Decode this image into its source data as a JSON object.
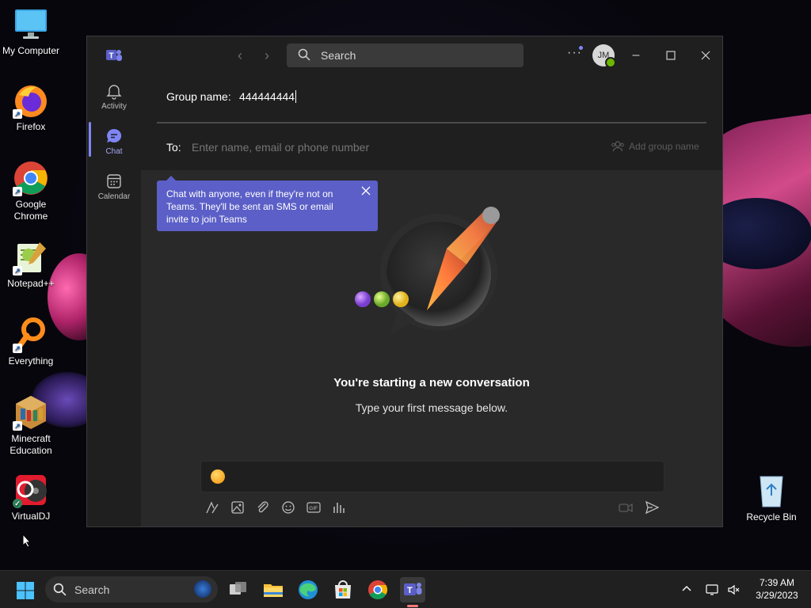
{
  "desktop": {
    "icons": [
      {
        "label": "My Computer"
      },
      {
        "label": "Firefox"
      },
      {
        "label": "Google Chrome"
      },
      {
        "label": "Notepad++"
      },
      {
        "label": "Everything"
      },
      {
        "label": "Minecraft Education"
      },
      {
        "label": "VirtualDJ"
      },
      {
        "label": "Recycle Bin"
      }
    ]
  },
  "teams": {
    "search_placeholder": "Search",
    "avatar_initials": "JM",
    "rail": [
      {
        "label": "Activity",
        "icon": "bell-icon"
      },
      {
        "label": "Chat",
        "icon": "chat-icon",
        "active": true
      },
      {
        "label": "Calendar",
        "icon": "calendar-icon"
      }
    ],
    "compose": {
      "group_name_label": "Group name:",
      "group_name_value": "444444444",
      "to_label": "To:",
      "to_placeholder": "Enter name, email or phone number",
      "add_group_name": "Add group name"
    },
    "tooltip_text": "Chat with anyone, even if they're not on Teams. They'll be sent an SMS or email invite to join Teams",
    "empty_state": {
      "title": "You're starting a new conversation",
      "subtitle": "Type your first message below."
    },
    "colors": {
      "accent": "#5b5fc7",
      "presence": "#6bb700"
    }
  },
  "taskbar": {
    "search_placeholder": "Search",
    "time": "7:39 AM",
    "date": "3/29/2023"
  }
}
